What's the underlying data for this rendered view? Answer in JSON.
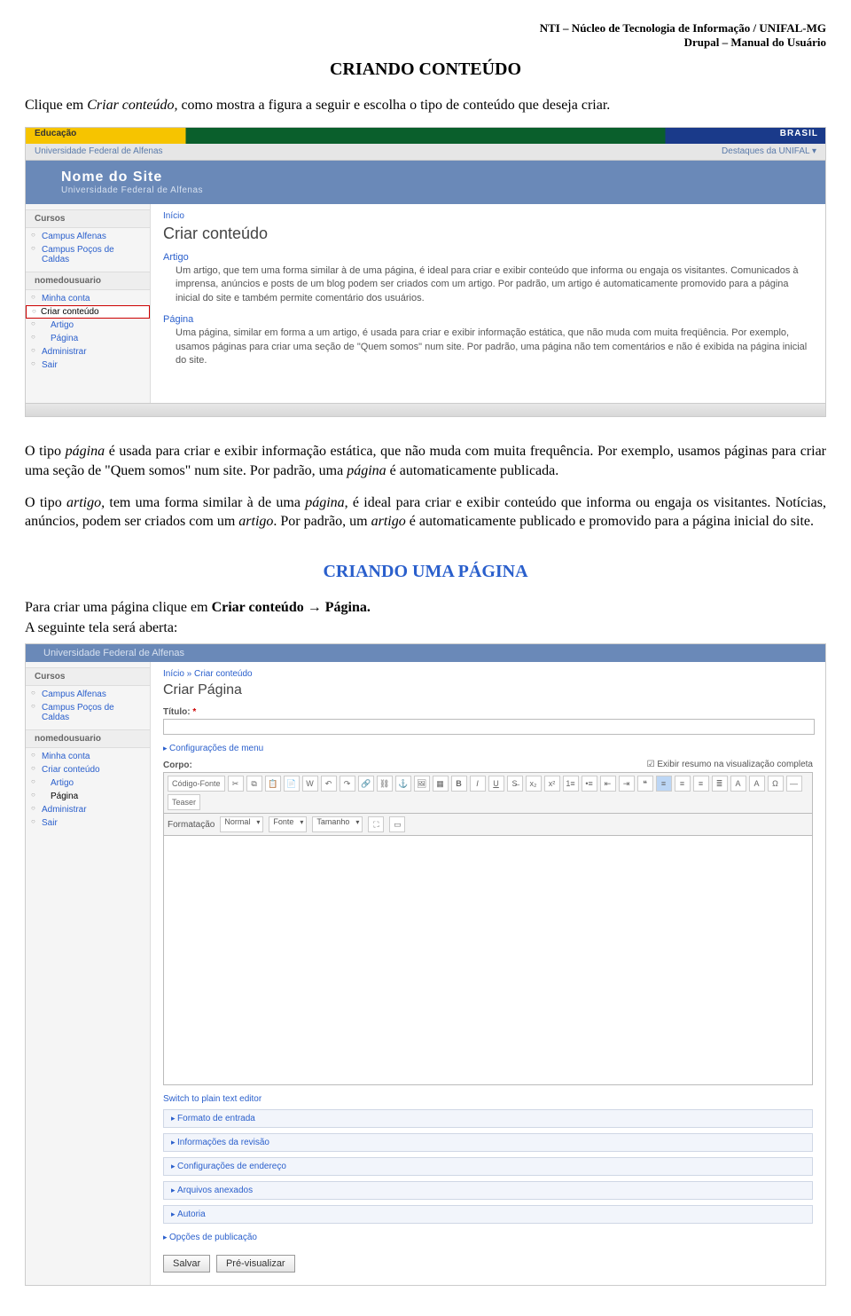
{
  "doc": {
    "header_l1": "NTI – Núcleo de Tecnologia de Informação / UNIFAL-MG",
    "header_l2": "Drupal – Manual do Usuário",
    "h1": "CRIANDO CONTEÚDO",
    "intro_1": "Clique em ",
    "intro_em": "Criar conteúdo,",
    "intro_2": " como mostra a figura a seguir e escolha o tipo de conteúdo que deseja criar.",
    "p2_a": "O tipo ",
    "p2_em1": "página",
    "p2_b": " é usada para criar e exibir informação estática, que não muda com muita frequência. Por exemplo, usamos páginas para criar uma seção de \"Quem somos\" num site. Por padrão, uma ",
    "p2_em2": "página",
    "p2_c": " é automaticamente publicada.",
    "p3_a": "O tipo ",
    "p3_em1": "artigo,",
    "p3_b": " tem uma forma similar à de uma ",
    "p3_em2": "página",
    "p3_c": ", é ideal para criar e exibir conteúdo que informa ou engaja os visitantes. Notícias, anúncios, podem ser criados com um ",
    "p3_em3": "artigo",
    "p3_d": ". Por padrão, um ",
    "p3_em4": "artigo",
    "p3_e": " é automaticamente publicado e promovido para a página inicial do site.",
    "h2": "CRIANDO UMA PÁGINA",
    "p4_a": "Para criar uma página clique em ",
    "p4_b1": "Criar conteúdo",
    "p4_arrow": " → ",
    "p4_b2": "Página.",
    "p5": "A seguinte tela será aberta:"
  },
  "shot1": {
    "educacao": "Educação",
    "brasil": "BRASIL",
    "univ": "Universidade Federal de Alfenas",
    "destaques": "Destaques da UNIFAL",
    "site_name": "Nome do Site",
    "site_sub": "Universidade Federal de Alfenas",
    "side_group1": "Cursos",
    "side_items1": [
      "Campus Alfenas",
      "Campus Poços de Caldas"
    ],
    "side_group2": "nomedousuario",
    "side_items2": [
      "Minha conta",
      "Criar conteúdo",
      "Artigo",
      "Página",
      "Administrar",
      "Sair"
    ],
    "breadcrumb": "Início",
    "page_title": "Criar conteúdo",
    "artigo_t": "Artigo",
    "artigo_d": "Um artigo, que tem uma forma similar à de uma página, é ideal para criar e exibir conteúdo que informa ou engaja os visitantes. Comunicados à imprensa, anúncios e posts de um blog podem ser criados com um artigo. Por padrão, um artigo é automaticamente promovido para a página inicial do site e também permite comentário dos usuários.",
    "pagina_t": "Página",
    "pagina_d": "Uma página, similar em forma a um artigo, é usada para criar e exibir informação estática, que não muda com muita freqüência. Por exemplo, usamos páginas para criar uma seção de \"Quem somos\" num site. Por padrão, uma página não tem comentários e não é exibida na página inicial do site."
  },
  "shot2": {
    "banner_sub": "Universidade Federal de Alfenas",
    "side_group1": "Cursos",
    "side_items1": [
      "Campus Alfenas",
      "Campus Poços de Caldas"
    ],
    "side_group2": "nomedousuario",
    "side_items2": [
      "Minha conta",
      "Criar conteúdo",
      "Artigo",
      "Página",
      "Administrar",
      "Sair"
    ],
    "breadcrumb": "Início » Criar conteúdo",
    "page_title": "Criar Página",
    "titulo_lbl": "Título:",
    "menu_cfg": "Configurações de menu",
    "corpo_lbl": "Corpo:",
    "chk_lbl": "Exibir resumo na visualização completa",
    "tb_src": "Código-Fonte",
    "tb_format_lbl": "Formatação",
    "tb_format_val": "Normal",
    "tb_font_lbl": "Fonte",
    "tb_size_lbl": "Tamanho",
    "tb_teaser": "Teaser",
    "switch": "Switch to plain text editor",
    "acc": [
      "Formato de entrada",
      "Informações da revisão",
      "Configurações de endereço",
      "Arquivos anexados",
      "Autoria",
      "Opções de publicação"
    ],
    "btn_save": "Salvar",
    "btn_preview": "Pré-visualizar"
  }
}
